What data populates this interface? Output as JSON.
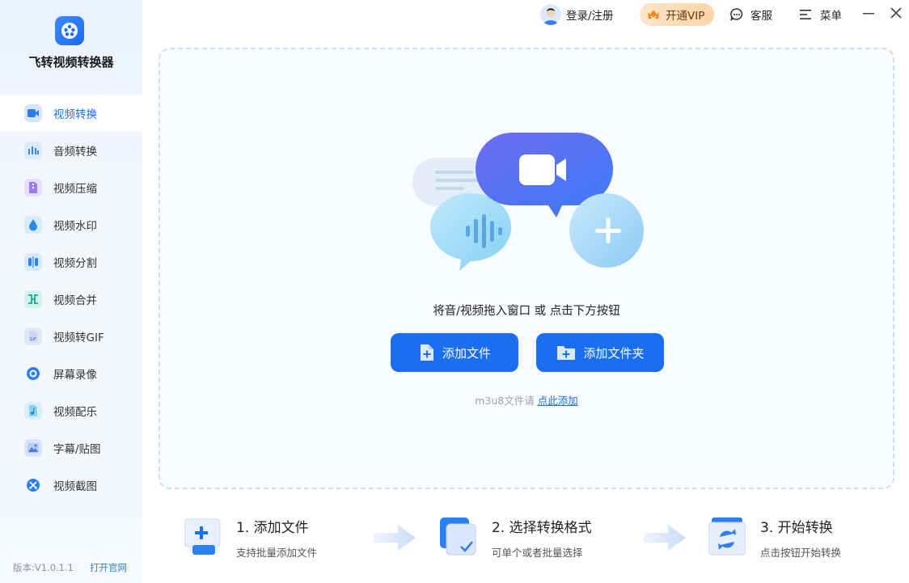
{
  "app": {
    "title": "飞转视频转换器",
    "version": "版本:V1.0.1.1",
    "website_link": "打开官网"
  },
  "topbar": {
    "login": "登录/注册",
    "vip": "开通VIP",
    "service": "客服",
    "menu": "菜单"
  },
  "sidebar": {
    "items": [
      {
        "label": "视频转换",
        "icon": "video-convert-icon",
        "active": true
      },
      {
        "label": "音频转换",
        "icon": "audio-convert-icon"
      },
      {
        "label": "视频压缩",
        "icon": "compress-icon"
      },
      {
        "label": "视频水印",
        "icon": "watermark-icon"
      },
      {
        "label": "视频分割",
        "icon": "split-icon"
      },
      {
        "label": "视频合并",
        "icon": "merge-icon"
      },
      {
        "label": "视频转GIF",
        "icon": "gif-icon"
      },
      {
        "label": "屏幕录像",
        "icon": "record-icon"
      },
      {
        "label": "视频配乐",
        "icon": "music-icon"
      },
      {
        "label": "字幕/贴图",
        "icon": "subtitle-icon"
      },
      {
        "label": "视频截图",
        "icon": "screenshot-icon"
      }
    ]
  },
  "dropzone": {
    "hint": "将音/视频拖入窗口 或 点击下方按钮",
    "add_file": "添加文件",
    "add_folder": "添加文件夹",
    "m3u8_prefix": "m3u8文件请",
    "m3u8_link": "点此添加"
  },
  "steps": [
    {
      "title": "1. 添加文件",
      "subtitle": "支持批量添加文件"
    },
    {
      "title": "2. 选择转换格式",
      "subtitle": "可单个或者批量选择"
    },
    {
      "title": "3. 开始转换",
      "subtitle": "点击按钮开始转换"
    }
  ],
  "colors": {
    "accent": "#1a6ff0",
    "sidebar_bg": "#eef4fc",
    "vip_bg": "#fbd3a6"
  }
}
